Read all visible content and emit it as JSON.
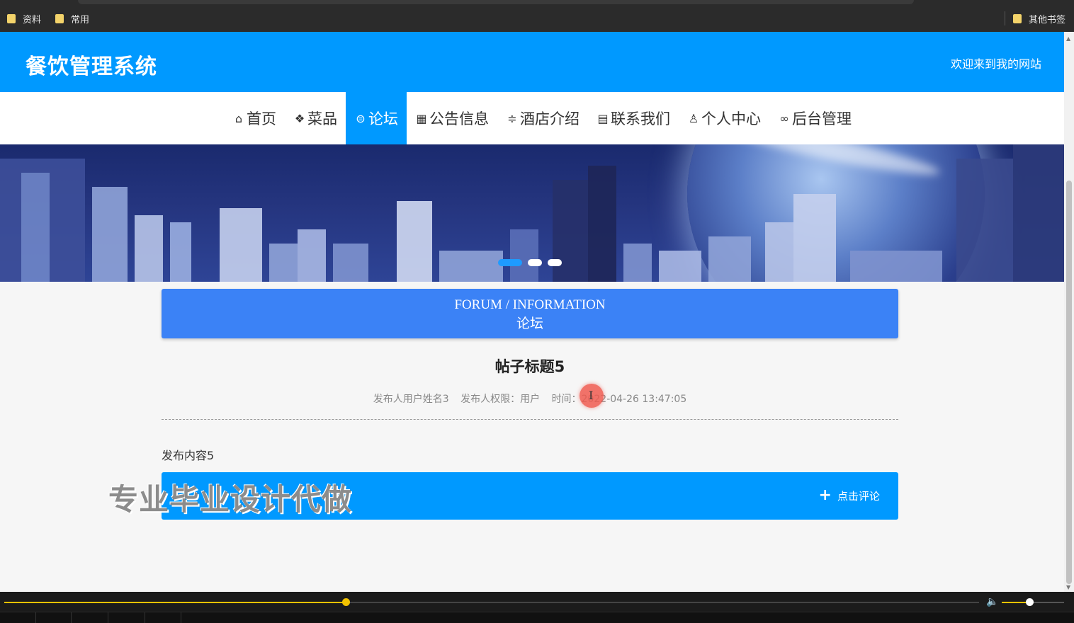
{
  "browser": {
    "bookmarks": [
      {
        "label": "资料"
      },
      {
        "label": "常用"
      }
    ],
    "other_bookmarks": "其他书签"
  },
  "site": {
    "title": "餐饮管理系统",
    "welcome": "欢迎来到我的网站"
  },
  "nav": {
    "items": [
      {
        "label": "首页",
        "icon": "home-icon",
        "glyph": "⌂"
      },
      {
        "label": "菜品",
        "icon": "layers-icon",
        "glyph": "❖"
      },
      {
        "label": "论坛",
        "icon": "forum-icon",
        "glyph": "⊜",
        "active": true
      },
      {
        "label": "公告信息",
        "icon": "grid-icon",
        "glyph": "▦"
      },
      {
        "label": "酒店介绍",
        "icon": "sliders-icon",
        "glyph": "≑"
      },
      {
        "label": "联系我们",
        "icon": "contact-card-icon",
        "glyph": "▤"
      },
      {
        "label": "个人中心",
        "icon": "user-icon",
        "glyph": "♙"
      },
      {
        "label": "后台管理",
        "icon": "link-icon",
        "glyph": "∞"
      }
    ]
  },
  "section": {
    "title_en": "FORUM / INFORMATION",
    "title_zh": "论坛"
  },
  "post": {
    "title": "帖子标题5",
    "author": "发布人用户姓名3",
    "role": "发布人权限：用户",
    "time": "时间：2022-04-26 13:47:05",
    "content": "发布内容5"
  },
  "comment": {
    "button_label": "点击评论"
  },
  "watermark": "专业毕业设计代做",
  "player": {
    "progress": 0.35,
    "volume": 0.44
  },
  "colors": {
    "brand": "#0099ff",
    "section_head": "#3b82f6",
    "player_accent": "#f2c200"
  }
}
